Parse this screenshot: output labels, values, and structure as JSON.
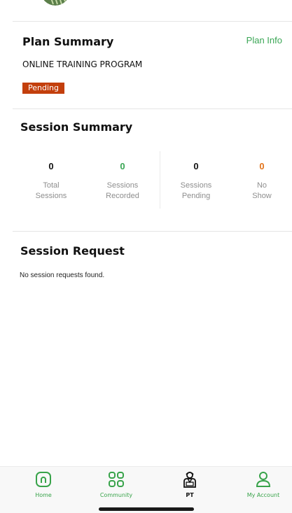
{
  "plan": {
    "title": "Plan Summary",
    "info_link": "Plan Info",
    "program_name": "ONLINE TRAINING PROGRAM",
    "status": "Pending"
  },
  "session_summary": {
    "title": "Session Summary",
    "stats": [
      {
        "value": "0",
        "label_line1": "Total",
        "label_line2": "Sessions",
        "color": "#111111"
      },
      {
        "value": "0",
        "label_line1": "Sessions",
        "label_line2": "Recorded",
        "color": "#3aa655"
      },
      {
        "value": "0",
        "label_line1": "Sessions",
        "label_line2": "Pending",
        "color": "#111111"
      },
      {
        "value": "0",
        "label_line1": "No",
        "label_line2": "Show",
        "color": "#e2741b"
      }
    ]
  },
  "session_request": {
    "title": "Session Request",
    "empty_message": "No session requests found."
  },
  "bottom_nav": {
    "items": [
      {
        "label": "Home",
        "icon": "home-icon"
      },
      {
        "label": "Community",
        "icon": "community-grid-icon"
      },
      {
        "label": "PT",
        "icon": "trainer-icon"
      },
      {
        "label": "My Account",
        "icon": "account-icon"
      }
    ],
    "active": "PT"
  },
  "colors": {
    "accent": "#3aa655",
    "pending_badge": "#c33f0c",
    "no_show": "#e2741b"
  }
}
